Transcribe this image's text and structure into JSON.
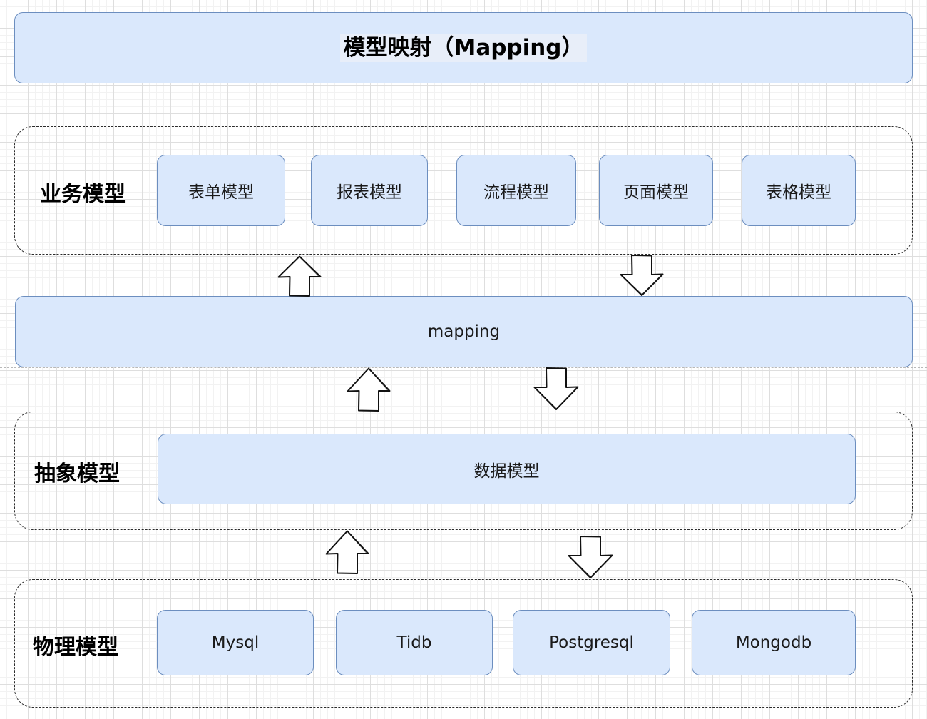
{
  "title": "模型映射（Mapping）",
  "layers": {
    "business": {
      "label": "业务模型",
      "items": [
        "表单模型",
        "报表模型",
        "流程模型",
        "页面模型",
        "表格模型"
      ]
    },
    "mapping": {
      "label": "mapping"
    },
    "abstract": {
      "label": "抽象模型",
      "items": [
        "数据模型"
      ]
    },
    "physical": {
      "label": "物理模型",
      "items": [
        "Mysql",
        "Tidb",
        "Postgresql",
        "Mongodb"
      ]
    }
  },
  "arrows": [
    {
      "from": "mapping",
      "to": "business",
      "direction": "up"
    },
    {
      "from": "business",
      "to": "mapping",
      "direction": "down"
    },
    {
      "from": "abstract",
      "to": "mapping",
      "direction": "up"
    },
    {
      "from": "mapping",
      "to": "abstract",
      "direction": "down"
    },
    {
      "from": "physical",
      "to": "abstract",
      "direction": "up"
    },
    {
      "from": "abstract",
      "to": "physical",
      "direction": "down"
    }
  ],
  "colors": {
    "box_fill": "#dae8fc",
    "box_stroke": "#6c8ebf",
    "container_stroke": "#2b2b2b"
  }
}
